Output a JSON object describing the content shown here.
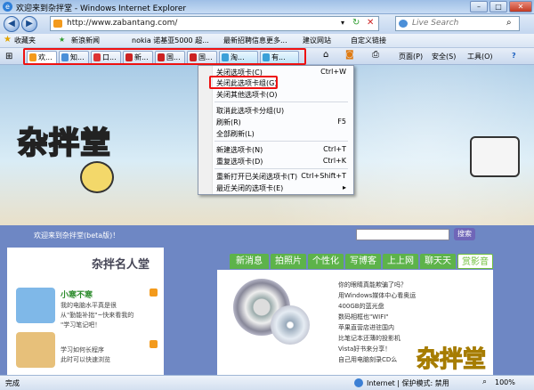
{
  "window": {
    "title": "欢迎来到杂拌堂 - Windows Internet Explorer",
    "minimize": "–",
    "maximize": "□",
    "close": "✕"
  },
  "address": {
    "url": "http://www.zabantang.com/",
    "search_placeholder": "Live Search"
  },
  "favorites_bar": {
    "items": [
      "收藏夹",
      "新浪新闻",
      "nokia 诺基亚5000 超...",
      "最新招聘信息更多...",
      "建议网站",
      "自定义链接"
    ]
  },
  "tabs": {
    "items": [
      "欢...",
      "知...",
      "口...",
      "新...",
      "国...",
      "国...",
      "淘...",
      "有..."
    ]
  },
  "toolbar": {
    "page": "页面(P)",
    "safety": "安全(S)",
    "tools": "工具(O)",
    "help": "?"
  },
  "context_menu": {
    "items": [
      {
        "label": "关闭选项卡(C)",
        "shortcut": "Ctrl+W"
      },
      {
        "label": "关闭此选项卡组(G)",
        "shortcut": ""
      },
      {
        "label": "关闭其他选项卡(O)",
        "shortcut": ""
      },
      {
        "label": "取消此选项卡分组(U)",
        "shortcut": ""
      },
      {
        "label": "刷新(R)",
        "shortcut": "F5"
      },
      {
        "label": "全部刷新(L)",
        "shortcut": ""
      },
      {
        "label": "新建选项卡(N)",
        "shortcut": "Ctrl+T"
      },
      {
        "label": "重复选项卡(D)",
        "shortcut": "Ctrl+K"
      },
      {
        "label": "重新打开已关闭选项卡(T)",
        "shortcut": "Ctrl+Shift+T"
      },
      {
        "label": "最近关闭的选项卡(E)",
        "shortcut": "▸"
      }
    ]
  },
  "page": {
    "logo": "杂拌堂",
    "welcome": "欢迎来到杂拌堂(beta版)！",
    "search_button": "搜索",
    "section_title": "杂拌名人堂",
    "nav_tabs": [
      "新消息",
      "拍照片",
      "个性化",
      "写博客",
      "上上网",
      "聊天天",
      "赏影音"
    ],
    "user_name": "小寒不寒",
    "left_text": [
      "我的电脑水平真是很",
      "从\"勤能补拙\"~快来看我的",
      "\"学习笔记吧！",
      "学习如何长程序",
      "此时可以快速浏览"
    ],
    "list_items": [
      "你的眼睛真能欺骗了吗？",
      "用Windows媒体中心看奥运",
      "400GB的蓝光盘",
      "数码相框也\"WIFI\"",
      "苹果直营店进驻国内",
      "比笔记本还薄的投影机",
      "Vista好书来分享！",
      "自己用电脑刻录CD么"
    ],
    "watermark": "杂拌堂"
  },
  "status": {
    "left": "完成",
    "zone": "Internet | 保护模式: 禁用",
    "zoom": "100%"
  }
}
